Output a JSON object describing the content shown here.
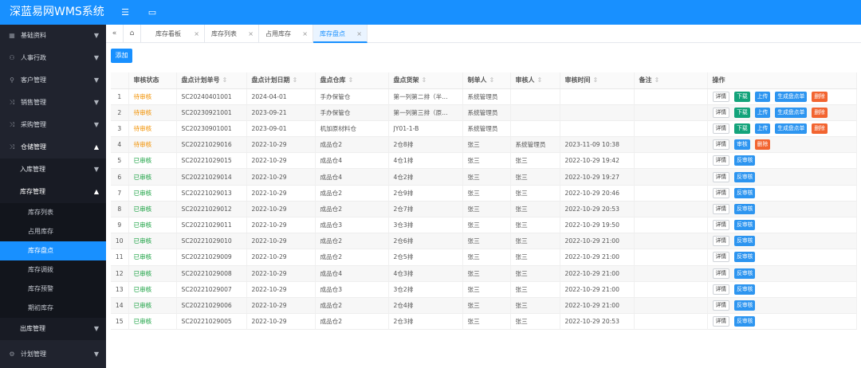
{
  "app": {
    "title": "深蓝易网WMS系统"
  },
  "sidebar": {
    "items": [
      {
        "label": "基础资料",
        "arrow": "▼"
      },
      {
        "label": "人事行政",
        "arrow": "▼"
      },
      {
        "label": "客户管理",
        "arrow": "▼"
      },
      {
        "label": "销售管理",
        "arrow": "▼"
      },
      {
        "label": "采购管理",
        "arrow": "▼"
      },
      {
        "label": "仓储管理",
        "arrow": "▲"
      }
    ],
    "warehouse_sub": [
      {
        "label": "入库管理",
        "arrow": "▼"
      },
      {
        "label": "库存管理",
        "arrow": "▲"
      }
    ],
    "inventory_sub": [
      "库存列表",
      "占用库存",
      "库存盘点",
      "库存调拨",
      "库存预警",
      "期初库存"
    ],
    "outbound": {
      "label": "出库管理",
      "arrow": "▼"
    },
    "plan": {
      "label": "计划管理",
      "arrow": "▼"
    }
  },
  "tabs": [
    {
      "label": "库存看板"
    },
    {
      "label": "库存列表"
    },
    {
      "label": "占用库存"
    },
    {
      "label": "库存盘点"
    }
  ],
  "toolbar": {
    "add_label": "添加"
  },
  "table": {
    "columns": [
      "审核状态",
      "盘点计划单号",
      "盘点计划日期",
      "盘点仓库",
      "盘点货架",
      "制单人",
      "审核人",
      "审核时间",
      "备注",
      "操作"
    ],
    "sort_glyph": "⇕",
    "op_labels": {
      "detail": "详情",
      "download": "下载",
      "upload": "上传",
      "generate": "生成盘点单",
      "delete": "删除",
      "audit": "审核",
      "unaudit": "反审核"
    },
    "rows": [
      {
        "no": "1",
        "status": "待审核",
        "plan_no": "SC20240401001",
        "date": "2024-04-01",
        "warehouse": "手办保管仓",
        "shelf": "第一列第二排（半...",
        "creator": "系统管理员",
        "auditor": "",
        "audit_time": "",
        "remark": ""
      },
      {
        "no": "2",
        "status": "待审核",
        "plan_no": "SC20230921001",
        "date": "2023-09-21",
        "warehouse": "手办保管仓",
        "shelf": "第一列第三排（原...",
        "creator": "系统管理员",
        "auditor": "",
        "audit_time": "",
        "remark": ""
      },
      {
        "no": "3",
        "status": "待审核",
        "plan_no": "SC20230901001",
        "date": "2023-09-01",
        "warehouse": "机加原材料仓",
        "shelf": "JY01-1-B",
        "creator": "系统管理员",
        "auditor": "",
        "audit_time": "",
        "remark": ""
      },
      {
        "no": "4",
        "status": "待审核",
        "plan_no": "SC20221029016",
        "date": "2022-10-29",
        "warehouse": "成品仓2",
        "shelf": "2仓8排",
        "creator": "张三",
        "auditor": "系统管理员",
        "audit_time": "2023-11-09 10:38",
        "remark": ""
      },
      {
        "no": "5",
        "status": "已审核",
        "plan_no": "SC20221029015",
        "date": "2022-10-29",
        "warehouse": "成品仓4",
        "shelf": "4仓1排",
        "creator": "张三",
        "auditor": "张三",
        "audit_time": "2022-10-29 19:42",
        "remark": ""
      },
      {
        "no": "6",
        "status": "已审核",
        "plan_no": "SC20221029014",
        "date": "2022-10-29",
        "warehouse": "成品仓4",
        "shelf": "4仓2排",
        "creator": "张三",
        "auditor": "张三",
        "audit_time": "2022-10-29 19:27",
        "remark": ""
      },
      {
        "no": "7",
        "status": "已审核",
        "plan_no": "SC20221029013",
        "date": "2022-10-29",
        "warehouse": "成品仓2",
        "shelf": "2仓9排",
        "creator": "张三",
        "auditor": "张三",
        "audit_time": "2022-10-29 20:46",
        "remark": ""
      },
      {
        "no": "8",
        "status": "已审核",
        "plan_no": "SC20221029012",
        "date": "2022-10-29",
        "warehouse": "成品仓2",
        "shelf": "2仓7排",
        "creator": "张三",
        "auditor": "张三",
        "audit_time": "2022-10-29 20:53",
        "remark": ""
      },
      {
        "no": "9",
        "status": "已审核",
        "plan_no": "SC20221029011",
        "date": "2022-10-29",
        "warehouse": "成品仓3",
        "shelf": "3仓3排",
        "creator": "张三",
        "auditor": "张三",
        "audit_time": "2022-10-29 19:50",
        "remark": ""
      },
      {
        "no": "10",
        "status": "已审核",
        "plan_no": "SC20221029010",
        "date": "2022-10-29",
        "warehouse": "成品仓2",
        "shelf": "2仓6排",
        "creator": "张三",
        "auditor": "张三",
        "audit_time": "2022-10-29 21:00",
        "remark": ""
      },
      {
        "no": "11",
        "status": "已审核",
        "plan_no": "SC20221029009",
        "date": "2022-10-29",
        "warehouse": "成品仓2",
        "shelf": "2仓5排",
        "creator": "张三",
        "auditor": "张三",
        "audit_time": "2022-10-29 21:00",
        "remark": ""
      },
      {
        "no": "12",
        "status": "已审核",
        "plan_no": "SC20221029008",
        "date": "2022-10-29",
        "warehouse": "成品仓4",
        "shelf": "4仓3排",
        "creator": "张三",
        "auditor": "张三",
        "audit_time": "2022-10-29 21:00",
        "remark": ""
      },
      {
        "no": "13",
        "status": "已审核",
        "plan_no": "SC20221029007",
        "date": "2022-10-29",
        "warehouse": "成品仓3",
        "shelf": "3仓2排",
        "creator": "张三",
        "auditor": "张三",
        "audit_time": "2022-10-29 21:00",
        "remark": ""
      },
      {
        "no": "14",
        "status": "已审核",
        "plan_no": "SC20221029006",
        "date": "2022-10-29",
        "warehouse": "成品仓2",
        "shelf": "2仓4排",
        "creator": "张三",
        "auditor": "张三",
        "audit_time": "2022-10-29 21:00",
        "remark": ""
      },
      {
        "no": "15",
        "status": "已审核",
        "plan_no": "SC20221029005",
        "date": "2022-10-29",
        "warehouse": "成品仓2",
        "shelf": "2仓3排",
        "creator": "张三",
        "auditor": "张三",
        "audit_time": "2022-10-29 20:53",
        "remark": ""
      }
    ]
  },
  "colors": {
    "primary": "#1890ff",
    "pending": "#f29100",
    "approved": "#19a141",
    "green_btn": "#13a37a",
    "red_btn": "#f26430",
    "sidebar_bg": "#20232e"
  }
}
